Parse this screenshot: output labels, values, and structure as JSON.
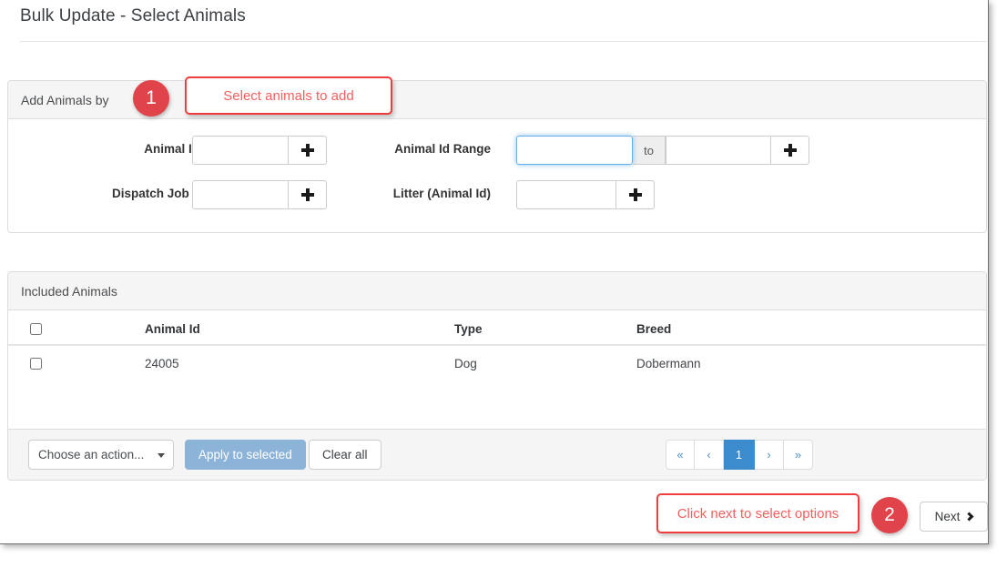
{
  "page": {
    "title": "Bulk Update - Select Animals"
  },
  "add_animals_panel": {
    "header": "Add Animals by",
    "fields": {
      "animal_id": {
        "label": "Animal Id",
        "value": "",
        "add_button_icon": "plus-icon"
      },
      "dispatch_job": {
        "label": "Dispatch Job #",
        "value": "",
        "add_button_icon": "plus-icon"
      },
      "animal_id_range": {
        "label": "Animal Id Range",
        "from_value": "",
        "separator": "to",
        "to_value": "",
        "add_button_icon": "plus-icon"
      },
      "litter": {
        "label": "Litter (Animal Id)",
        "value": "",
        "add_button_icon": "plus-icon"
      }
    }
  },
  "included_animals_panel": {
    "header": "Included Animals",
    "columns": [
      "",
      "Animal Id",
      "Type",
      "Breed"
    ],
    "rows": [
      {
        "selected": false,
        "animal_id": "24005",
        "type": "Dog",
        "breed": "Dobermann"
      }
    ],
    "footer": {
      "action_select": {
        "selected": "Choose an action...",
        "caret_icon": "chevron-down-icon"
      },
      "apply_label": "Apply to selected",
      "clear_label": "Clear all",
      "pagination": {
        "first": "«",
        "prev": "‹",
        "pages": [
          "1"
        ],
        "active_page": "1",
        "next": "›",
        "last": "»"
      }
    }
  },
  "next_button": {
    "label": "Next",
    "icon": "chevron-right-icon"
  },
  "annotations": [
    {
      "number": "1",
      "text": "Select animals to add"
    },
    {
      "number": "2",
      "text": "Click next to select options"
    }
  ],
  "colors": {
    "accent_blue": "#3b8bcd",
    "muted_blue": "#8cb4d9",
    "annotation_red": "#e0434a",
    "annotation_text": "#f0605f",
    "panel_head": "#f5f5f5",
    "border": "#dddddd"
  }
}
